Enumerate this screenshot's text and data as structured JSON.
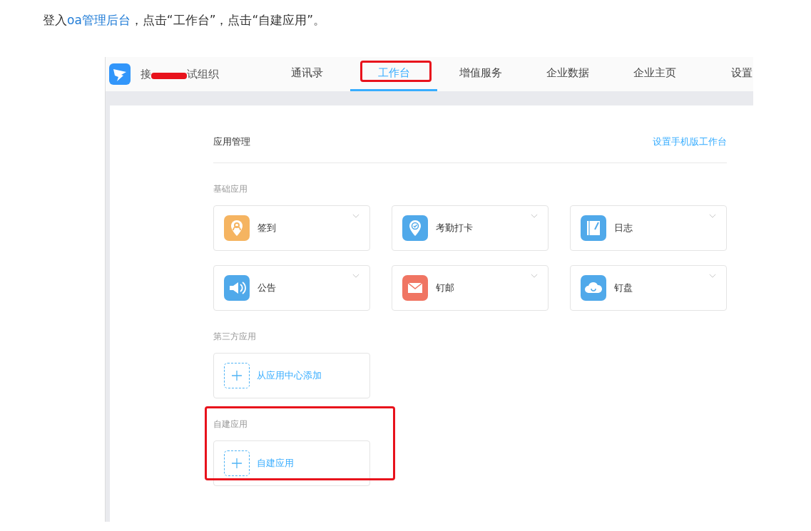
{
  "intro": {
    "before": "登入",
    "link": "oa管理后台",
    "after": "，点击“工作台”，点击“自建应用”。"
  },
  "header": {
    "org_name_start": "接",
    "org_name_end": "试组织",
    "redacted": true,
    "tabs": [
      {
        "label": "通讯录",
        "selected": false,
        "highlighted": false
      },
      {
        "label": "工作台",
        "selected": true,
        "highlighted": true
      },
      {
        "label": "增值服务",
        "selected": false,
        "highlighted": false
      },
      {
        "label": "企业数据",
        "selected": false,
        "highlighted": false
      },
      {
        "label": "企业主页",
        "selected": false,
        "highlighted": false
      },
      {
        "label": "设置",
        "selected": false,
        "highlighted": false
      }
    ]
  },
  "panel": {
    "title": "应用管理",
    "link": "设置手机版工作台",
    "sections": [
      {
        "title": "基础应用",
        "highlighted": false,
        "apps": [
          {
            "kind": "signin",
            "label": "签到",
            "color": "#f5b461"
          },
          {
            "kind": "attendance",
            "label": "考勤打卡",
            "color": "#50a9ea"
          },
          {
            "kind": "log",
            "label": "日志",
            "color": "#50a9ea"
          },
          {
            "kind": "notice",
            "label": "公告",
            "color": "#50a9ea"
          },
          {
            "kind": "mail",
            "label": "钉邮",
            "color": "#f07563"
          },
          {
            "kind": "disk",
            "label": "钉盘",
            "color": "#50a9ea"
          }
        ]
      },
      {
        "title": "第三方应用",
        "highlighted": false,
        "apps": [
          {
            "kind": "add",
            "label": "从应用中心添加"
          }
        ]
      },
      {
        "title": "自建应用",
        "highlighted": true,
        "apps": [
          {
            "kind": "add",
            "label": "自建应用"
          }
        ]
      }
    ]
  }
}
